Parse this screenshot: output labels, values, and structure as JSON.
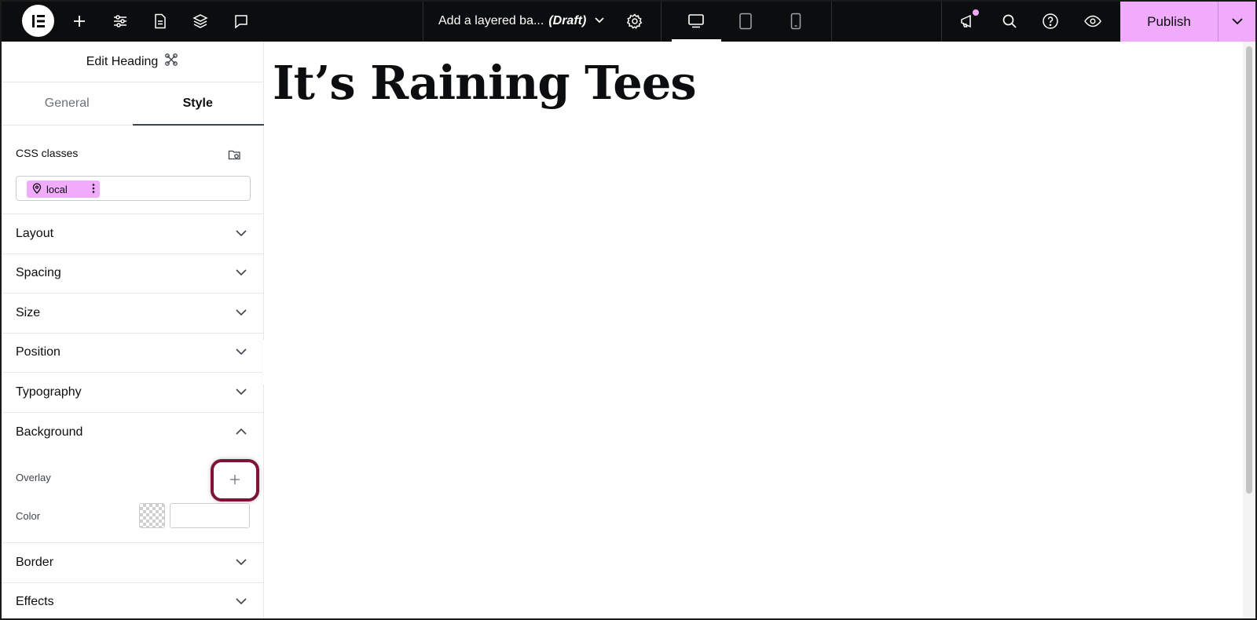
{
  "topbar": {
    "doc_title": "Add a layered ba...",
    "doc_status": "(Draft)",
    "publish_label": "Publish"
  },
  "panel": {
    "title": "Edit Heading",
    "tabs": [
      {
        "label": "General",
        "active": false
      },
      {
        "label": "Style",
        "active": true
      }
    ],
    "css_classes_label": "CSS classes",
    "class_chip": "local",
    "sections": {
      "layout": "Layout",
      "spacing": "Spacing",
      "size": "Size",
      "position": "Position",
      "typography": "Typography",
      "background": "Background",
      "border": "Border",
      "effects": "Effects"
    },
    "background": {
      "overlay_label": "Overlay",
      "color_label": "Color",
      "color_value": ""
    }
  },
  "canvas": {
    "heading": "It’s Raining Tees"
  },
  "colors": {
    "topbar_bg": "#0c0d0e",
    "accent_pink": "#f0abfc",
    "highlight_ring": "#7e1336"
  }
}
